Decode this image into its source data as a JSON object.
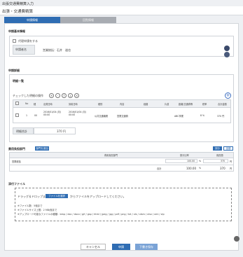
{
  "window": {
    "title": "出張交通費精算入力"
  },
  "page": {
    "heading": "出張・交通費精算"
  },
  "tabs": [
    {
      "label": "申請情報"
    },
    {
      "label": "回覧情報"
    }
  ],
  "basic": {
    "section_title": "申請基本情報",
    "proxy_label": "代理申請をする",
    "applicant_label": "申請者名",
    "applicant_value": "営業統括：石井　道也"
  },
  "detail": {
    "section_title": "申請詳細",
    "list_title": "明細一覧",
    "bulk_label": "チェックした明細の操作",
    "columns": [
      "No",
      "種",
      "出発日時",
      "到着日時",
      "種別",
      "内容",
      "経路",
      "片道",
      "距離/交通費等",
      "税率",
      "合計金額"
    ],
    "row": {
      "no": "1",
      "type_icon": "00",
      "depart": "2016/01/04 (月) 00:00",
      "arrive": "2016/01/04 (月) 00:00",
      "kind": "公共交通機関",
      "content": "営業交通費",
      "route": "",
      "oneway": "ABC事業",
      "rate": "8 %",
      "amount": "370 円"
    },
    "total_label": "明細合計",
    "total_value": "370 円"
  },
  "dept": {
    "section_title": "費用負担部門",
    "dept_btn": "部門を追加",
    "equal_btn": "按分",
    "clear_btn": "金額",
    "col_name": "費用負担部門",
    "col_ratio": "按分比率",
    "col_amount": "負担額",
    "row_name": "営業統括",
    "row_ratio": "100.00",
    "row_ratio_unit": "%",
    "row_amount": "370",
    "row_amount_unit": "円",
    "total_label": "合計",
    "total_ratio": "100.00",
    "total_ratio_unit": "%",
    "total_amount": "370",
    "total_amount_unit": "円"
  },
  "attach": {
    "section_title": "添付ファイル",
    "drop_prefix": "ドラッグ＆ドロップまたは",
    "select_btn": "ファイルを選択",
    "drop_suffix": "からファイルをアップロードしてください。",
    "note1": "※ファイル数：5個まで",
    "note2": "※ファイルサイズ上限：2 MB/個まで",
    "note3": "※アップロード可能なファイルの種類：bmp / doc / docx / gif / gsp / html / jpeg / jpg / pdf / png / txt / xls / xlsm / xlsx / xml / zip"
  },
  "footer": {
    "cancel": "キャンセル",
    "submit": "申請",
    "draft": "下書き保存"
  }
}
